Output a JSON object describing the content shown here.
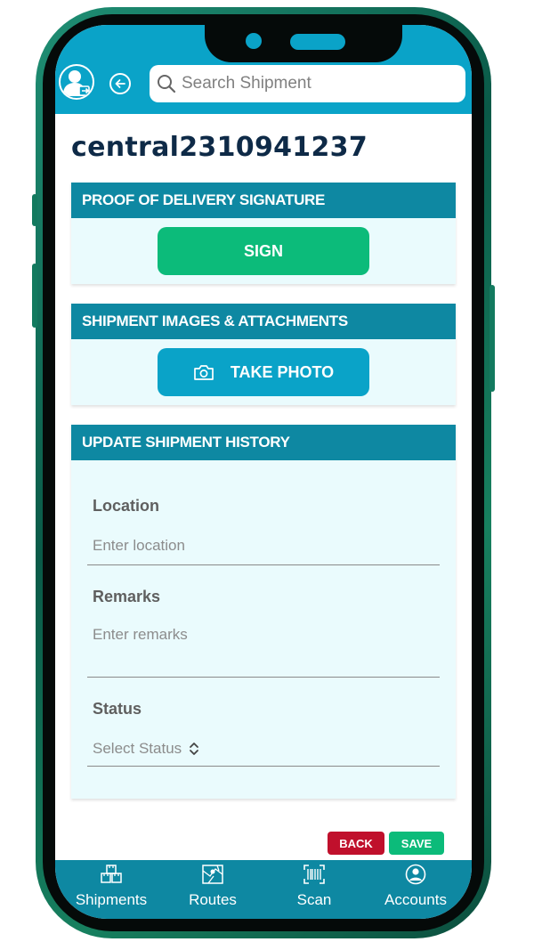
{
  "header": {
    "search_placeholder": "Search Shipment"
  },
  "page": {
    "title": "central2310941237"
  },
  "sections": {
    "signature": {
      "heading": "PROOF OF DELIVERY SIGNATURE",
      "button": "SIGN"
    },
    "images": {
      "heading": "SHIPMENT IMAGES & ATTACHMENTS",
      "button": "TAKE PHOTO"
    },
    "history": {
      "heading": "UPDATE SHIPMENT HISTORY",
      "location_label": "Location",
      "location_placeholder": "Enter location",
      "remarks_label": "Remarks",
      "remarks_placeholder": "Enter remarks",
      "status_label": "Status",
      "status_placeholder": "Select Status"
    }
  },
  "actions": {
    "back": "BACK",
    "save": "SAVE"
  },
  "nav": [
    {
      "label": "Shipments",
      "icon": "boxes-icon"
    },
    {
      "label": "Routes",
      "icon": "map-icon"
    },
    {
      "label": "Scan",
      "icon": "barcode-icon"
    },
    {
      "label": "Accounts",
      "icon": "user-circle-icon"
    }
  ],
  "colors": {
    "header": "#0aa3c8",
    "section_head": "#0e88a2",
    "sign": "#0cbb7a",
    "back": "#c0102c"
  }
}
